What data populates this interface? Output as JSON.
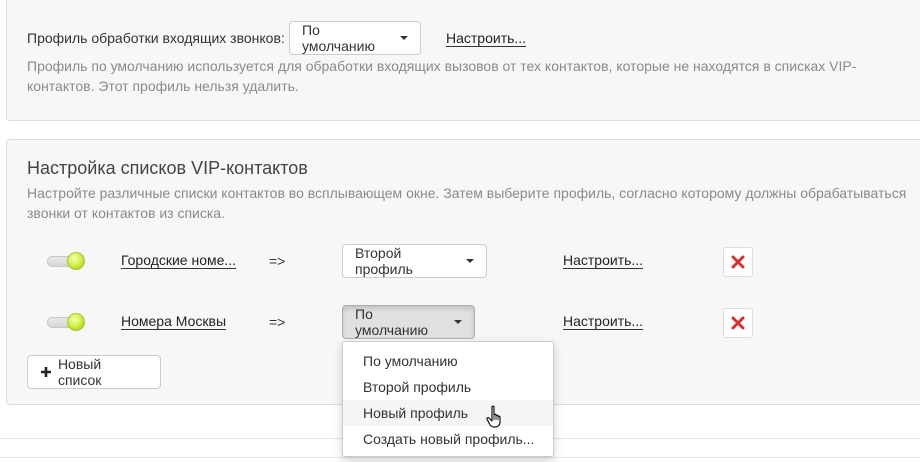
{
  "profile_section": {
    "label": "Профиль обработки входящих звонков:",
    "select_value": "По умолчанию",
    "configure_link": "Настроить...",
    "description_line1": "Профиль по умолчанию используется для обработки входящих вызовов от тех контактов, которые не находятся в списках VIP-",
    "description_line2": "контактов. Этот профиль нельзя удалить."
  },
  "vip_section": {
    "title": "Настройка списков VIP-контактов",
    "description_line1": "Настройте различные списки контактов во всплывающем окне. Затем выберите профиль, согласно которому должны обрабатываться",
    "description_line2": "звонки от контактов из списка.",
    "rows": [
      {
        "list_name": "Городские номе...",
        "arrow": "=>",
        "profile": "Второй профиль",
        "configure_link": "Настроить..."
      },
      {
        "list_name": "Номера Москвы",
        "arrow": "=>",
        "profile": "По умолчанию",
        "configure_link": "Настроить..."
      }
    ],
    "new_list_button": "Новый список"
  },
  "dropdown": {
    "items": [
      "По умолчанию",
      "Второй профиль",
      "Новый профиль",
      "Создать новый профиль..."
    ],
    "hovered_index": 2
  },
  "colors": {
    "panel_bg": "#f7f7f7",
    "delete_icon": "#d9302c",
    "toggle_on": "#c9ec3a"
  },
  "icons": {
    "toggle": "toggle-switch-icon",
    "delete": "close-x-icon",
    "plus": "plus-icon",
    "cursor": "hand-pointer-icon"
  }
}
